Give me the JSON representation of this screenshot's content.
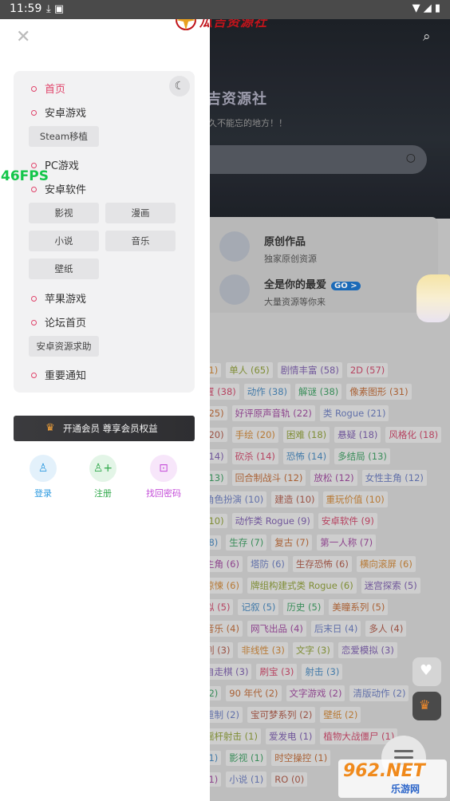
{
  "status_bar": {
    "time": "11:59"
  },
  "header": {
    "logo_text": "瓜吉资源社"
  },
  "drawer": {
    "nav": [
      {
        "label": "首页"
      },
      {
        "label": "安卓游戏"
      },
      {
        "label": "PC游戏"
      },
      {
        "label": "安卓软件"
      },
      {
        "label": "苹果游戏"
      },
      {
        "label": "论坛首页"
      },
      {
        "label": "重要通知"
      }
    ],
    "subs": {
      "android_games": [
        "Steam移植"
      ],
      "android_soft": [
        "影视",
        "漫画",
        "小说",
        "音乐",
        "壁纸"
      ],
      "forum": [
        "安卓资源求助"
      ]
    },
    "vip_label": "开通会员 尊享会员权益",
    "account": {
      "login": "登录",
      "register": "注册",
      "recover": "找回密码"
    }
  },
  "fps_overlay": "46FPS",
  "background": {
    "site_title": "吉资源社",
    "slogan": "久不能忘的地方！！",
    "cards": [
      {
        "title": "原创作品",
        "subtitle": "独家原创资源",
        "badge": ""
      },
      {
        "title": "全是你的最爱",
        "subtitle": "大量资源等你来",
        "badge": "GO >"
      }
    ],
    "tag_rows": [
      [
        "(1)",
        "单人 (65)",
        "剧情丰富 (58)",
        "2D (57)"
      ],
      [
        "置 (38)",
        "动作 (38)",
        "解谜 (38)",
        "像素图形 (31)"
      ],
      [
        "(25)",
        "好评原声音轨 (22)",
        "类 Rogue (21)"
      ],
      [
        "(20)",
        "手绘 (20)",
        "困难 (18)",
        "悬疑 (18)",
        "风格化 (18)"
      ],
      [
        "(14)",
        "砍杀 (14)",
        "恐怖 (14)",
        "多结局 (13)"
      ],
      [
        "(13)",
        "回合制战斗 (12)",
        "放松 (12)",
        "女性主角 (12)"
      ],
      [
        "角色扮演 (10)",
        "建造 (10)",
        "重玩价值 (10)"
      ],
      [
        "(10)",
        "动作类 Rogue (9)",
        "安卓软件 (9)"
      ],
      [
        "(8)",
        "生存 (7)",
        "复古 (7)",
        "第一人称 (7)"
      ],
      [
        "主角 (6)",
        "塔防 (6)",
        "生存恐怖 (6)",
        "横向滚屏 (6)"
      ],
      [
        "惊悚 (6)",
        "牌组构建式类 Rogue (6)",
        "迷宫探索 (5)"
      ],
      [
        "拟 (5)",
        "记叙 (5)",
        "历史 (5)",
        "美瞳系列 (5)"
      ],
      [
        "音乐 (4)",
        "网飞出品 (4)",
        "后末日 (4)",
        "多人 (4)"
      ],
      [
        "列 (3)",
        "非线性 (3)",
        "文字 (3)",
        "恋爱模拟 (3)"
      ],
      [
        "自走棋 (3)",
        "刷宝 (3)",
        "射击 (3)"
      ],
      [
        "(2)",
        "90 年代 (2)",
        "文字游戏 (2)",
        "清版动作 (2)"
      ],
      [
        "重制 (2)",
        "宝可梦系列 (2)",
        "壁纸 (2)"
      ],
      [
        "揺杆射击 (1)",
        "爱发电 (1)",
        "植物大战僵尸 (1)"
      ],
      [
        "(1)",
        "影视 (1)",
        "时空操控 (1)"
      ],
      [
        "(1)",
        "小说 (1)",
        "RO (0)"
      ]
    ]
  },
  "watermark": {
    "brand": "962.NET",
    "sub": "乐游网"
  },
  "colors": {
    "accent": "#e0436a",
    "login": "#2f9be0",
    "register": "#2fa84a",
    "recover": "#c44dd8"
  }
}
